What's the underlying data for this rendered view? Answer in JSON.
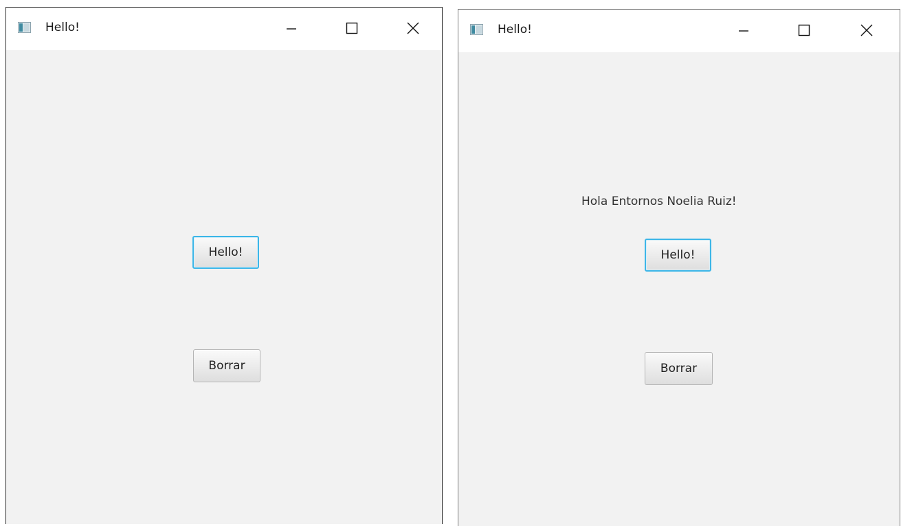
{
  "windows": [
    {
      "title": "Hello!",
      "message": "",
      "hello_button": "Hello!",
      "clear_button": "Borrar"
    },
    {
      "title": "Hello!",
      "message": "Hola Entornos Noelia Ruiz!",
      "hello_button": "Hello!",
      "clear_button": "Borrar"
    }
  ],
  "icons": {
    "app": "app-window-icon",
    "minimize": "minimize-icon",
    "maximize": "maximize-icon",
    "close": "close-icon"
  },
  "colors": {
    "focus_ring": "#3cb6e8",
    "client_bg": "#f2f2f2",
    "titlebar_bg": "#ffffff"
  }
}
